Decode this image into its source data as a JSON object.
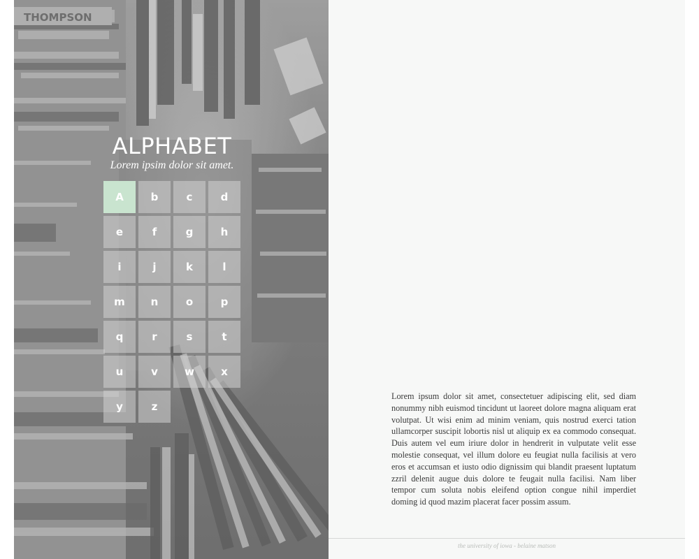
{
  "hero": {
    "title": "ALPHABET",
    "subtitle": "Lorem ipsim dolor sit amet.",
    "photo_sign_text": "THOMPSON"
  },
  "alphabet": {
    "letters": [
      "A",
      "b",
      "c",
      "d",
      "e",
      "f",
      "g",
      "h",
      "i",
      "j",
      "k",
      "l",
      "m",
      "n",
      "o",
      "p",
      "q",
      "r",
      "s",
      "t",
      "u",
      "v",
      "w",
      "x",
      "y",
      "z"
    ],
    "active_letter": "A",
    "active_color": "#c9e4cf"
  },
  "article": {
    "body": "Lorem ipsum dolor sit amet, consectetuer adipiscing elit, sed diam nonummy nibh euismod tincidunt ut laoreet dolore magna aliquam erat volutpat. Ut wisi enim ad minim veniam, quis nostrud exerci tation ullamcorper suscipit lobortis nisl ut aliquip ex ea commodo consequat. Duis autem vel eum iriure dolor in hendrerit in vulputate velit esse molestie consequat, vel illum dolore eu feugiat nulla facilisis at vero eros et accumsan et iusto odio dignissim qui blandit praesent luptatum zzril delenit augue duis dolore te feugait nulla facilisi. Nam liber tempor cum soluta nobis eleifend option congue nihil imperdiet doming id quod mazim placerat facer possim assum."
  },
  "footer": {
    "text": "the university of iowa - belaine matson"
  }
}
